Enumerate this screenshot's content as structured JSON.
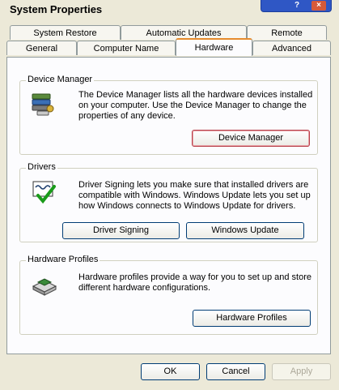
{
  "window": {
    "title": "System Properties",
    "help_label": "?",
    "close_label": "×"
  },
  "tabs": {
    "row1": [
      {
        "label": "System Restore"
      },
      {
        "label": "Automatic Updates"
      },
      {
        "label": "Remote"
      }
    ],
    "row2": [
      {
        "label": "General"
      },
      {
        "label": "Computer Name"
      },
      {
        "label": "Hardware",
        "active": true
      },
      {
        "label": "Advanced"
      }
    ]
  },
  "device_manager": {
    "group_label": "Device Manager",
    "description": "The Device Manager lists all the hardware devices installed on your computer. Use the Device Manager to change the properties of any device.",
    "button": "Device Manager",
    "icon": "device-manager-icon"
  },
  "drivers": {
    "group_label": "Drivers",
    "description": "Driver Signing lets you make sure that installed drivers are compatible with Windows. Windows Update lets you set up how Windows connects to Windows Update for drivers.",
    "signing_button": "Driver Signing",
    "update_button": "Windows Update",
    "icon": "driver-signing-icon"
  },
  "hardware_profiles": {
    "group_label": "Hardware Profiles",
    "description": "Hardware profiles provide a way for you to set up and store different hardware configurations.",
    "button": "Hardware Profiles",
    "icon": "hardware-profiles-icon"
  },
  "footer": {
    "ok": "OK",
    "cancel": "Cancel",
    "apply": "Apply"
  },
  "colors": {
    "dialog_bg": "#ece9d8",
    "panel_bg": "#fcfcfe",
    "active_tab_accent": "#e68b2c",
    "button_border": "#003c74"
  }
}
